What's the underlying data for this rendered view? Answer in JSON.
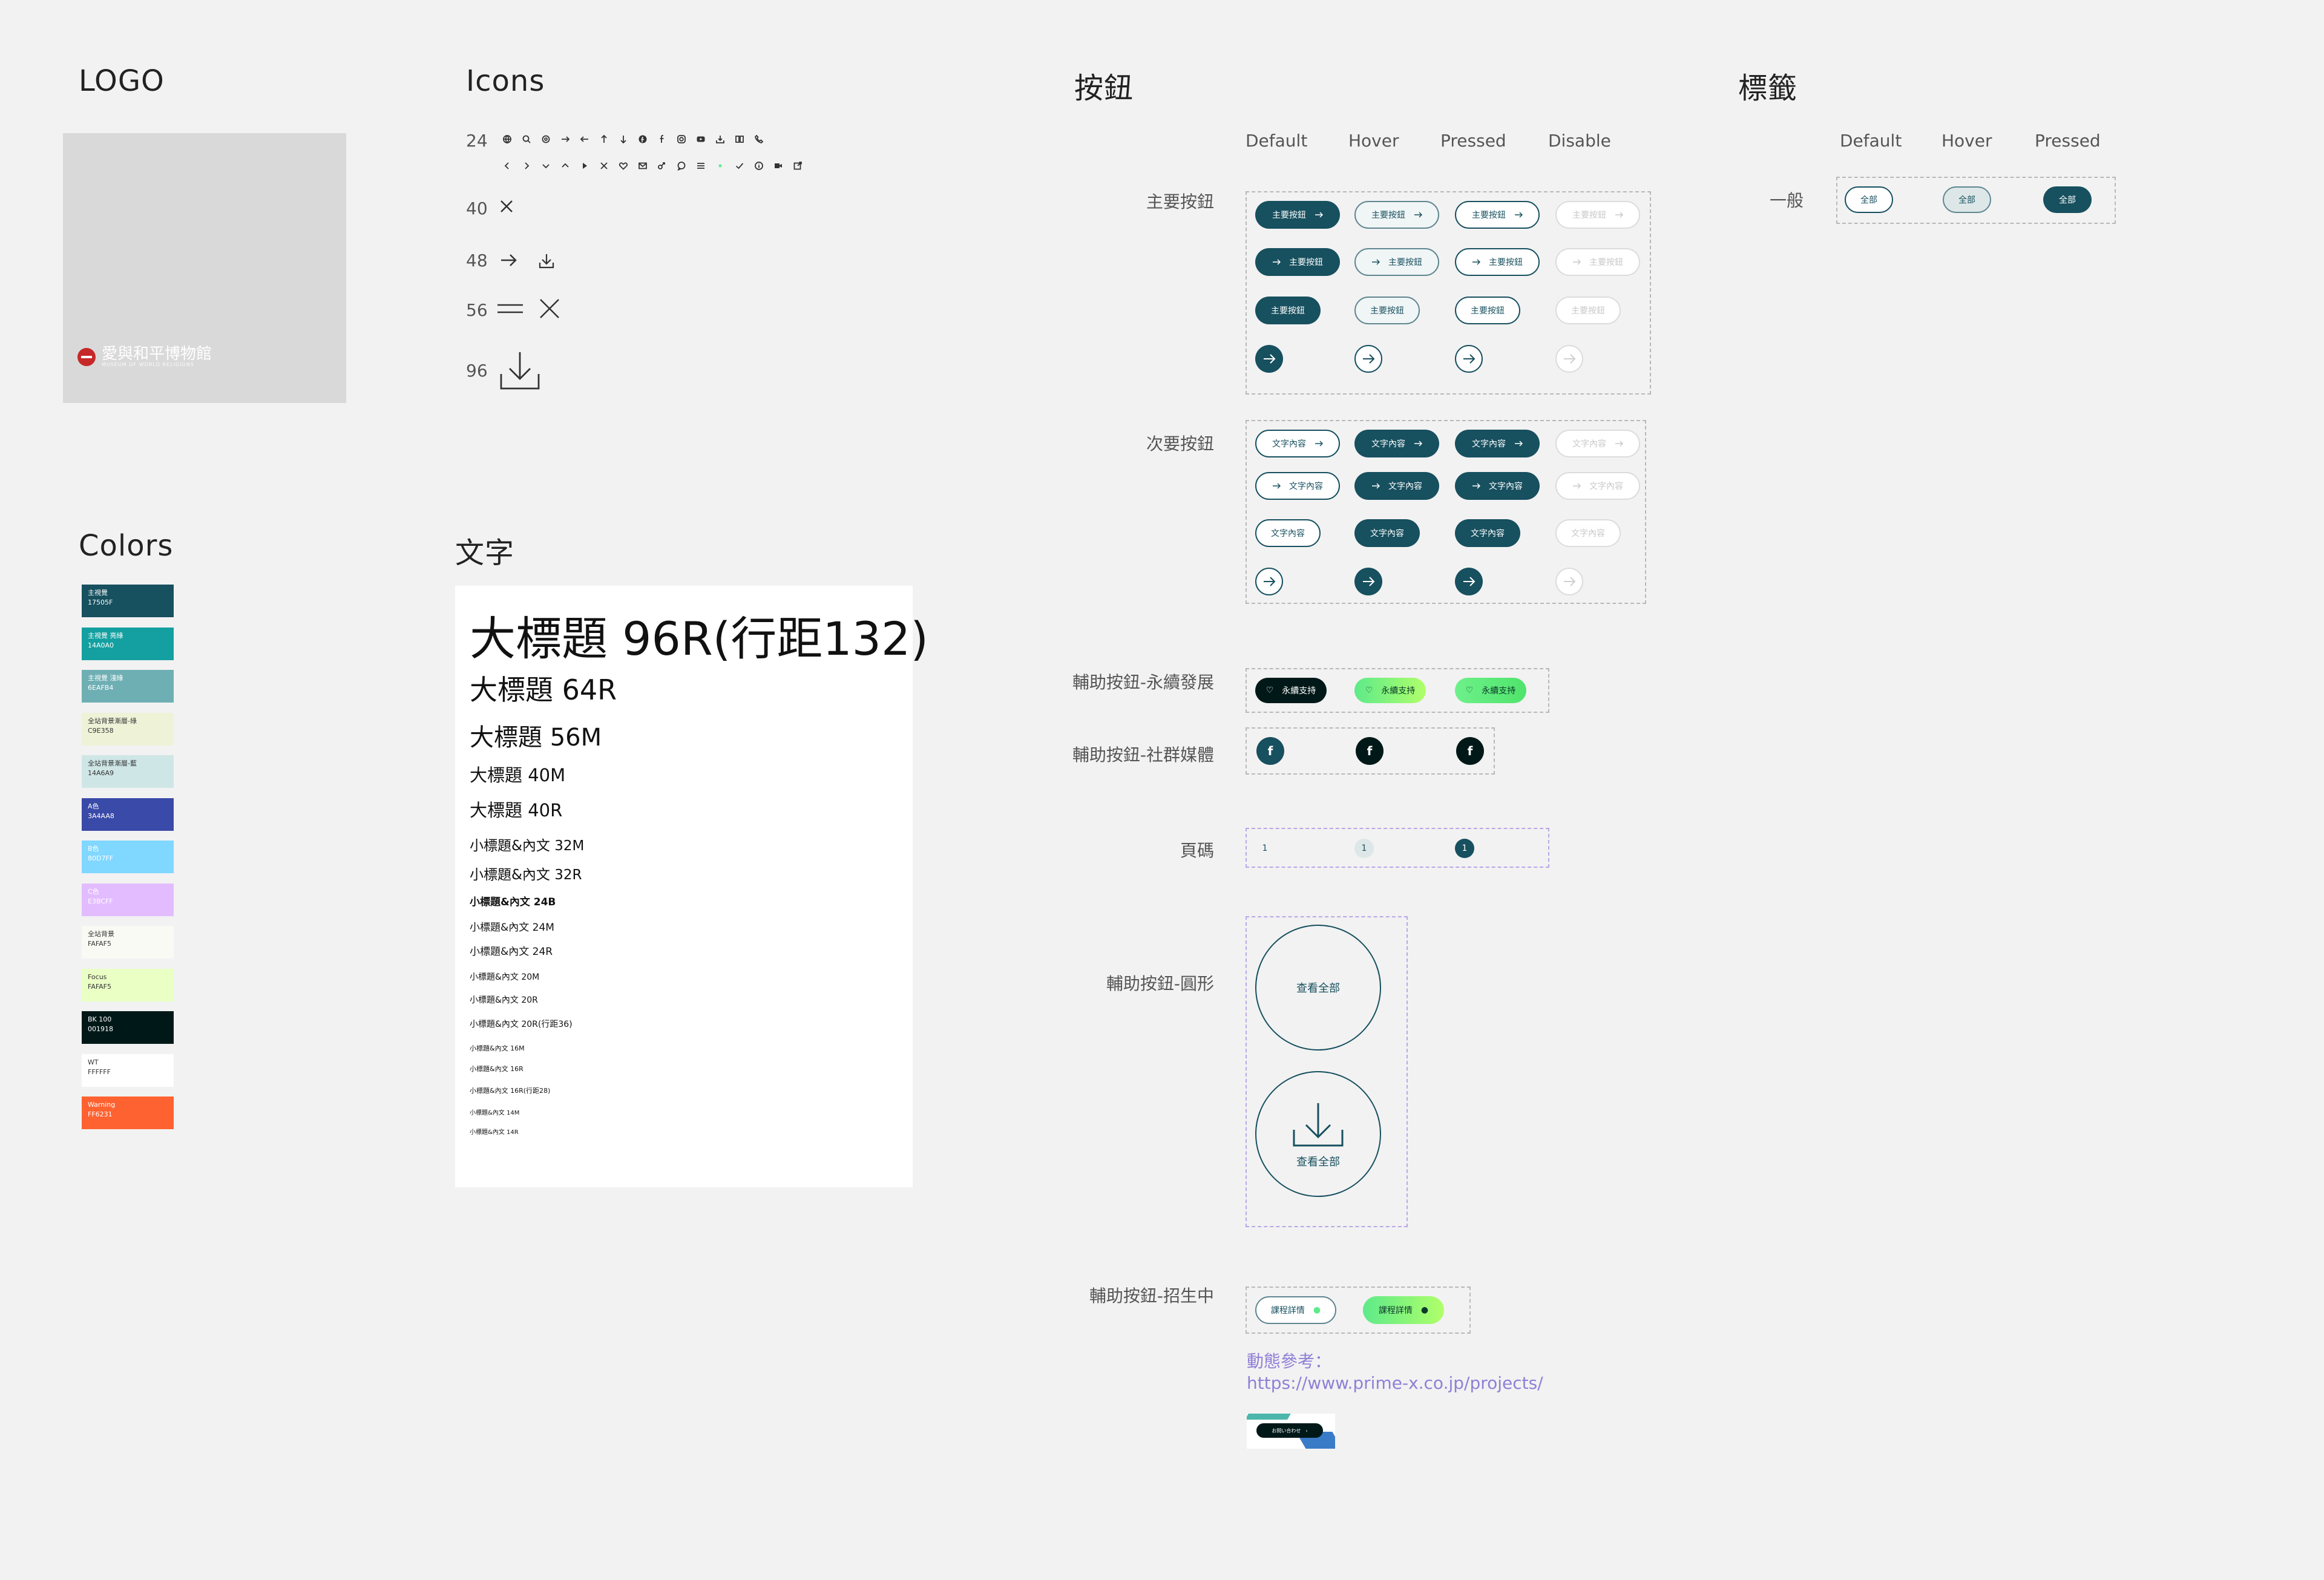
{
  "sections": {
    "logo": "LOGO",
    "icons": "Icons",
    "buttons": "按鈕",
    "tags": "標籤",
    "colors": "Colors",
    "typography": "文字"
  },
  "logo": {
    "name": "愛與和平博物館",
    "subtitle": "MUSEUM OF WORLD RELIGIONS"
  },
  "icons": {
    "sizes": [
      "24",
      "40",
      "48",
      "56",
      "96"
    ],
    "row1": [
      "globe-icon",
      "search-icon",
      "settings-icon",
      "arrow-right-icon",
      "arrow-left-icon",
      "arrow-up-icon",
      "arrow-down-icon",
      "facebook-icon",
      "facebook-f-icon",
      "instagram-icon",
      "youtube-icon",
      "download-icon",
      "book-icon",
      "phone-icon"
    ],
    "row2": [
      "chevron-left-icon",
      "chevron-right-icon",
      "chevron-down-icon",
      "chevron-up-icon",
      "play-icon",
      "close-icon",
      "heart-icon",
      "mail-icon",
      "share-icon",
      "chat-icon",
      "menu-icon",
      "dot-icon",
      "check-icon",
      "info-icon",
      "video-icon",
      "external-link-icon"
    ]
  },
  "colors": [
    {
      "name": "主視覺",
      "hex": "17505F",
      "color": "#17505f",
      "dark_text": false
    },
    {
      "name": "主視覺 亮綠",
      "hex": "14A0A0",
      "color": "#14a0a0",
      "dark_text": false
    },
    {
      "name": "主視覺 淺綠",
      "hex": "6EAFB4",
      "color": "#6eafb4",
      "dark_text": false
    },
    {
      "name": "全站背景漸層-綠",
      "hex": "C9E358",
      "color": "#eef3d8",
      "dark_text": true
    },
    {
      "name": "全站背景漸層-藍",
      "hex": "14A6A9",
      "color": "#cfe6e6",
      "dark_text": true
    },
    {
      "name": "A色",
      "hex": "3A4AA8",
      "color": "#3a4aa8",
      "dark_text": false
    },
    {
      "name": "B色",
      "hex": "80D7FF",
      "color": "#80d7ff",
      "dark_text": false
    },
    {
      "name": "C色",
      "hex": "E3BCFF",
      "color": "#e3bcff",
      "dark_text": false
    },
    {
      "name": "全站背景",
      "hex": "FAFAF5",
      "color": "#fafaf5",
      "dark_text": true
    },
    {
      "name": "Focus",
      "hex": "FAFAF5",
      "color": "#eaffc4",
      "dark_text": true
    },
    {
      "name": "BK 100",
      "hex": "001918",
      "color": "#001918",
      "dark_text": false
    },
    {
      "name": "WT",
      "hex": "FFFFFF",
      "color": "#ffffff",
      "dark_text": true
    },
    {
      "name": "Warning",
      "hex": "FF6231",
      "color": "#ff6231",
      "dark_text": false
    }
  ],
  "typography": [
    {
      "text": "大標題 96R(行距132)",
      "size": 76,
      "weight": 400
    },
    {
      "text": "大標題 64R",
      "size": 46,
      "weight": 400
    },
    {
      "text": "大標題 56M",
      "size": 40,
      "weight": 500
    },
    {
      "text": "大標題 40M",
      "size": 29,
      "weight": 500
    },
    {
      "text": "大標題 40R",
      "size": 29,
      "weight": 400
    },
    {
      "text": "小標題&內文 32M",
      "size": 23,
      "weight": 500
    },
    {
      "text": "小標題&內文 32R",
      "size": 23,
      "weight": 400
    },
    {
      "text": "小標題&內文 24B",
      "size": 17,
      "weight": 700
    },
    {
      "text": "小標題&內文 24M",
      "size": 17,
      "weight": 500
    },
    {
      "text": "小標題&內文 24R",
      "size": 17,
      "weight": 400
    },
    {
      "text": "小標題&內文 20M",
      "size": 14,
      "weight": 500
    },
    {
      "text": "小標題&內文 20R",
      "size": 14,
      "weight": 400
    },
    {
      "text": "小標題&內文 20R(行距36)",
      "size": 14,
      "weight": 400
    },
    {
      "text": "小標題&內文 16M",
      "size": 11,
      "weight": 500
    },
    {
      "text": "小標題&內文 16R",
      "size": 11,
      "weight": 400
    },
    {
      "text": "小標題&內文 16R(行距28)",
      "size": 11,
      "weight": 400
    },
    {
      "text": "小標題&內文 14M",
      "size": 10,
      "weight": 500
    },
    {
      "text": "小標題&內文 14R",
      "size": 10,
      "weight": 400
    }
  ],
  "buttons": {
    "col_heads": [
      "Default",
      "Hover",
      "Pressed",
      "Disable"
    ],
    "primary_label": "主要按鈕",
    "primary_text": "主要按鈕",
    "secondary_label": "次要按鈕",
    "secondary_text": "文字內容",
    "eco_label": "輔助按鈕-永續發展",
    "eco_text": "永續支持",
    "social_label": "輔助按鈕-社群媒體",
    "page_label": "頁碼",
    "page_num": "1",
    "circle_label": "輔助按鈕-圓形",
    "circle_text": "查看全部",
    "enroll_label": "輔助按鈕-招生中",
    "enroll_text": "課程詳情",
    "ref_label": "動態參考：",
    "ref_url": "https://www.prime-x.co.jp/projects/",
    "ref_thumb_text": "お問い合わせ"
  },
  "tags": {
    "col_heads": [
      "Default",
      "Hover",
      "Pressed"
    ],
    "row_label": "一般",
    "text": "全部"
  }
}
